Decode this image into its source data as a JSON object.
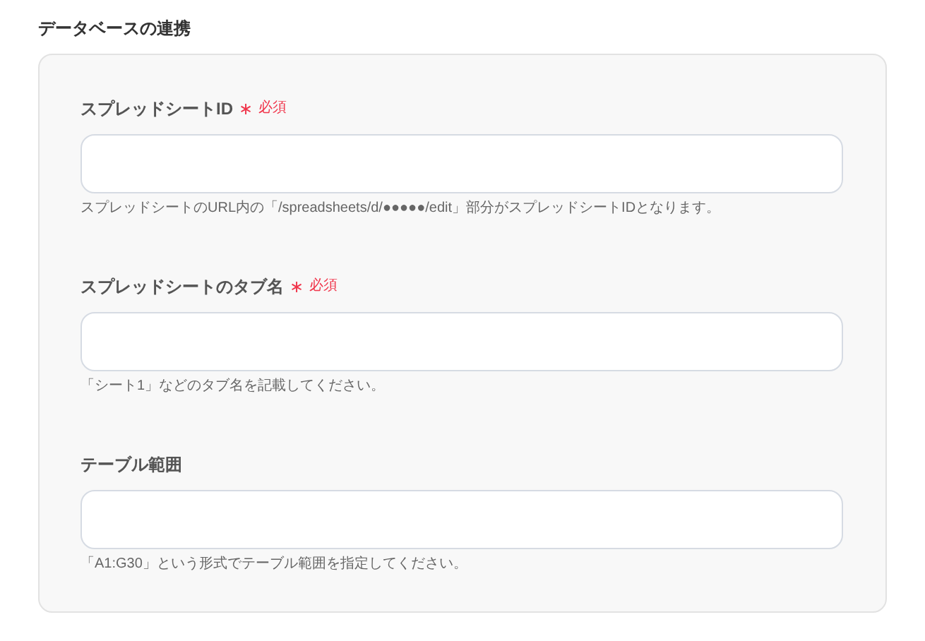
{
  "section_title": "データベースの連携",
  "fields": [
    {
      "label": "スプレッドシートID",
      "required": {
        "asterisk": "∗",
        "text": "必須"
      },
      "hint": "スプレッドシートのURL内の「/spreadsheets/d/●●●●●/edit」部分がスプレッドシートIDとなります。"
    },
    {
      "label": "スプレッドシートのタブ名",
      "required": {
        "asterisk": "∗",
        "text": "必須"
      },
      "hint": "「シート1」などのタブ名を記載してください。"
    },
    {
      "label": "テーブル範囲",
      "hint": "「A1:G30」という形式でテーブル範囲を指定してください。"
    }
  ]
}
